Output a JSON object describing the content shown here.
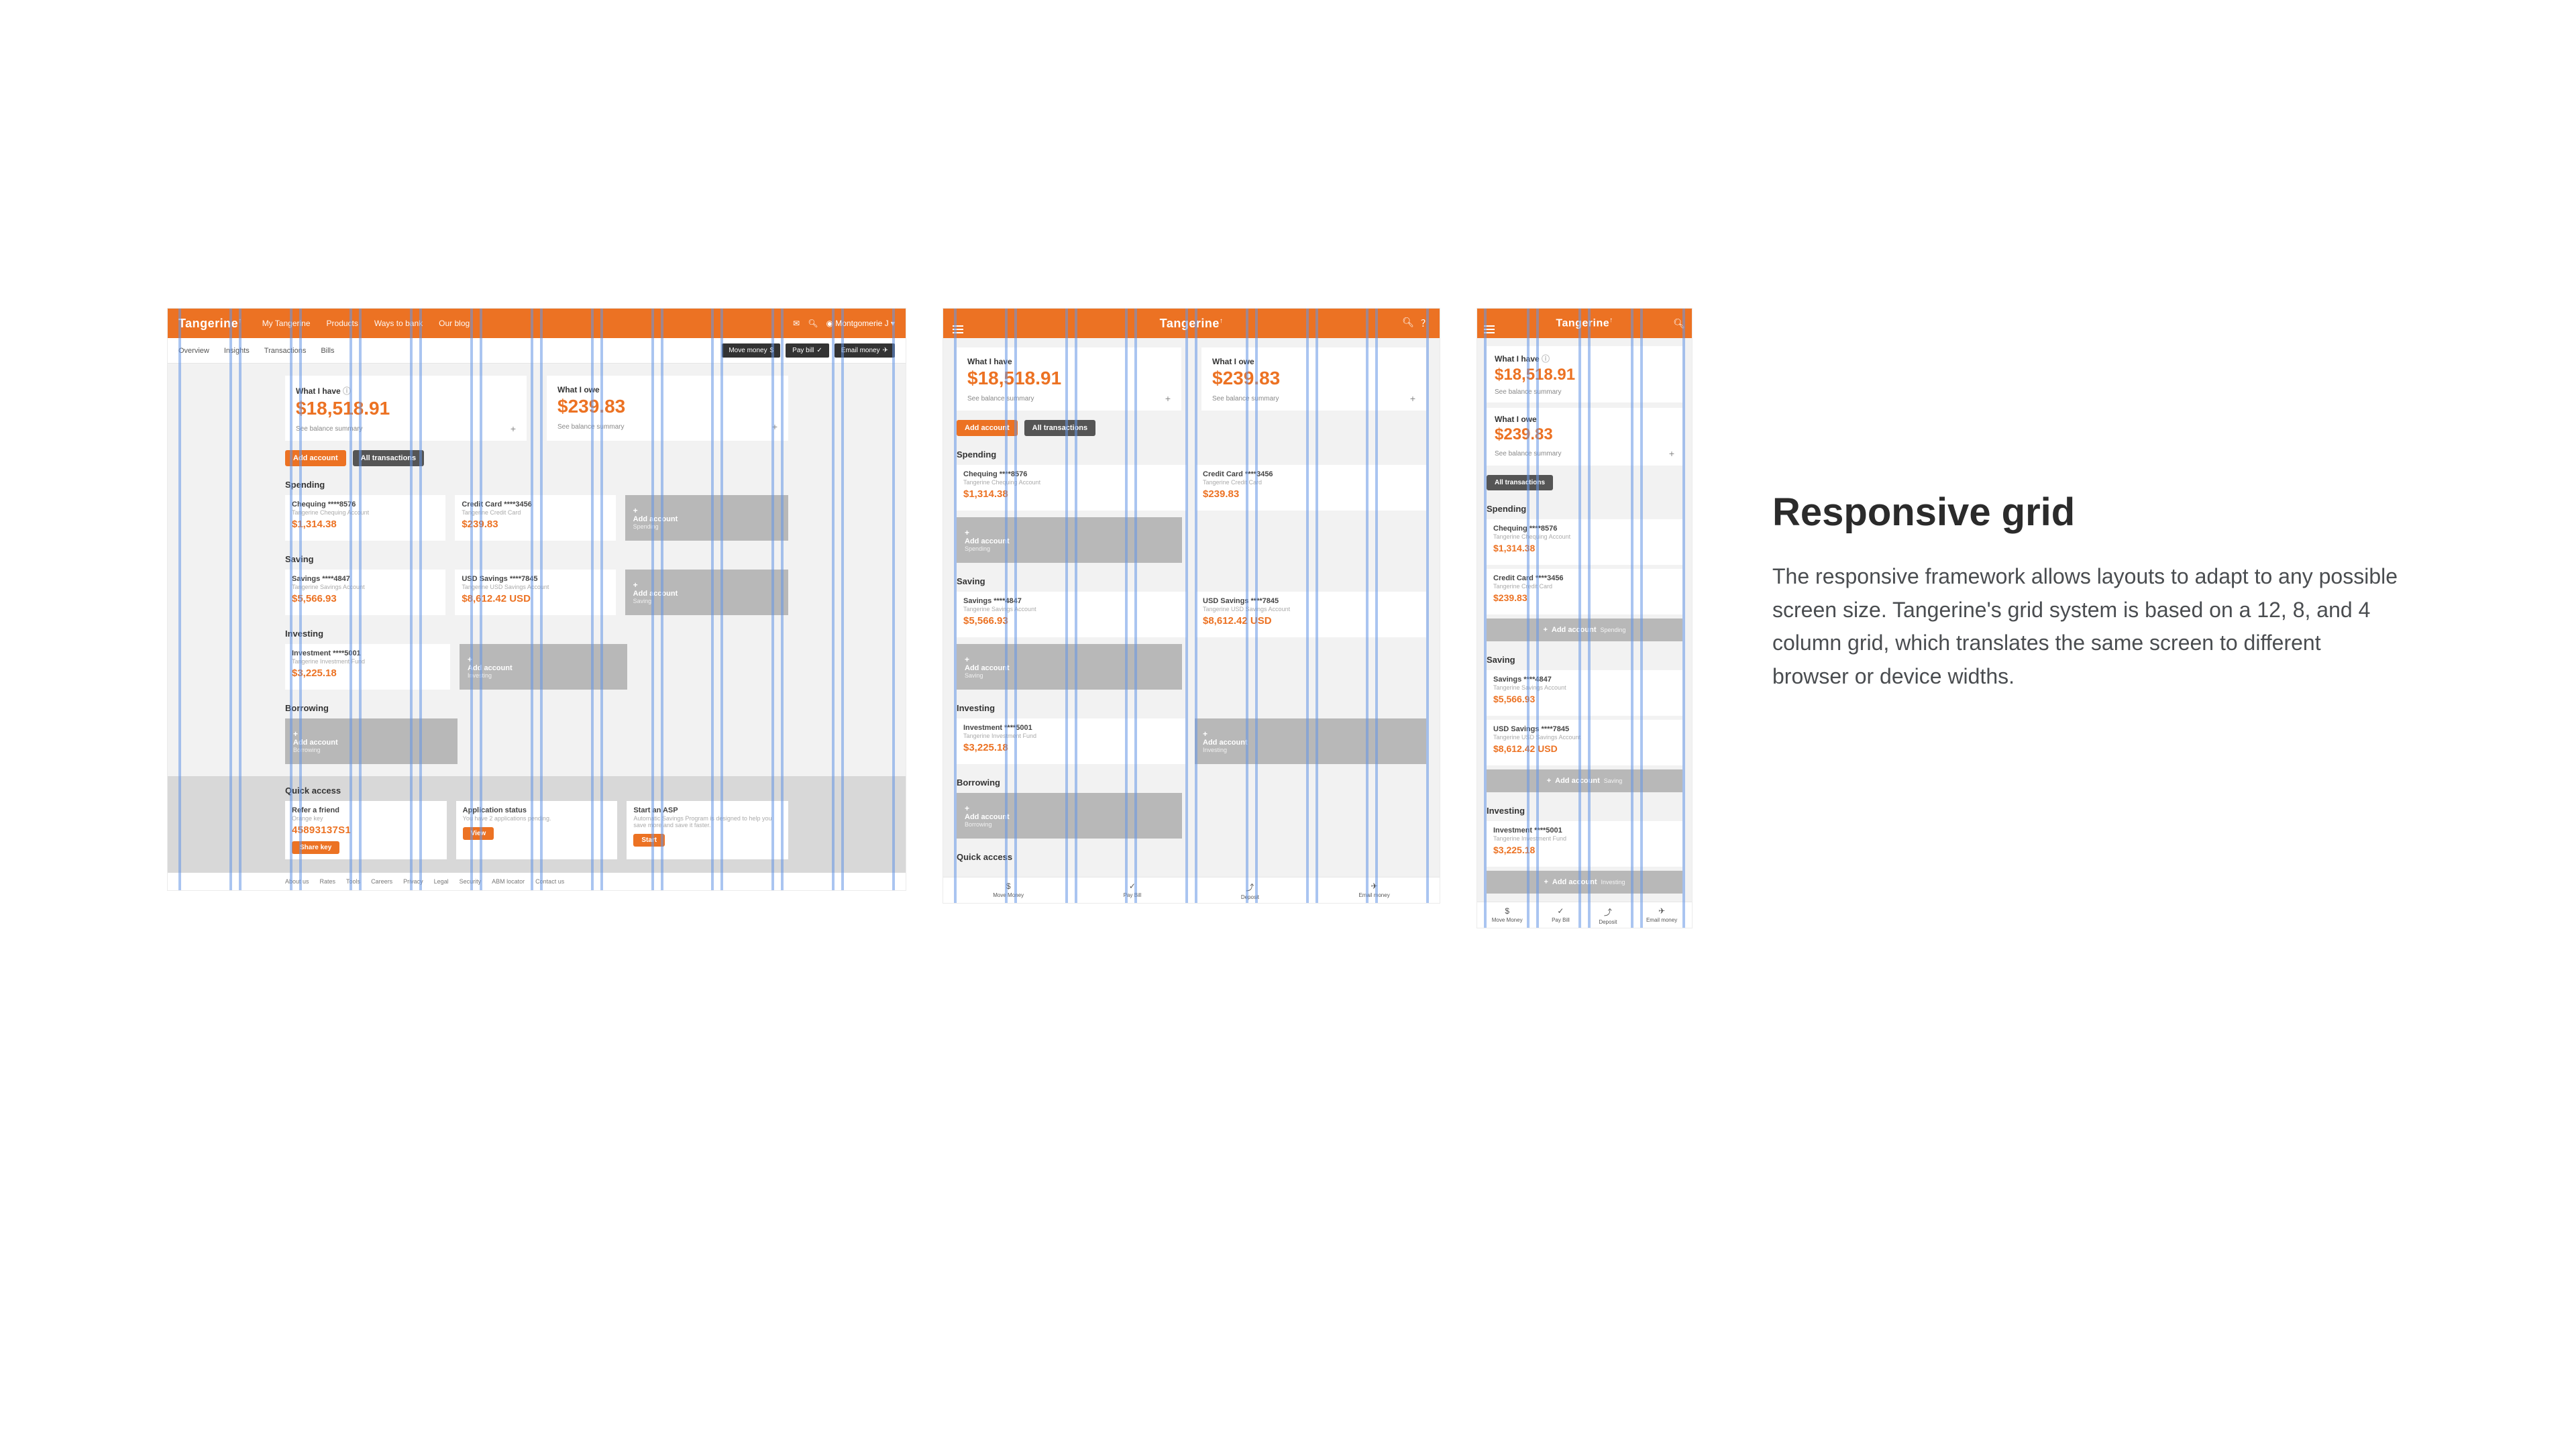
{
  "article": {
    "heading": "Responsive grid",
    "body": "The responsive framework allows layouts to adapt to any possible screen size. Tangerine's grid system is based on a 12, 8, and 4 column grid, which translates the same screen to different browser or device widths."
  },
  "brand": "Tangerine",
  "desktop_nav": [
    "My Tangerine",
    "Products",
    "Ways to bank",
    "Our blog"
  ],
  "desktop_user": "Montgomerie J",
  "desktop_tabs": [
    "Overview",
    "Insights",
    "Transactions",
    "Bills"
  ],
  "dark_actions": [
    "Move money",
    "Pay bill",
    "Email money"
  ],
  "summaries": {
    "have": {
      "label": "What I have",
      "amount": "$18,518.91",
      "sub": "See balance summary"
    },
    "owe": {
      "label": "What I owe",
      "amount": "$239.83",
      "sub": "See balance summary"
    }
  },
  "buttons": {
    "add_account": "Add account",
    "all_tx": "All transactions"
  },
  "sections": {
    "spending": "Spending",
    "saving": "Saving",
    "investing": "Investing",
    "borrowing": "Borrowing",
    "quick": "Quick access"
  },
  "accounts": {
    "chequing": {
      "title": "Chequing ****8576",
      "sub": "Tangerine Chequing Account",
      "amt": "$1,314.38"
    },
    "credit": {
      "title": "Credit Card ****3456",
      "sub": "Tangerine Credit Card",
      "amt": "$239.83"
    },
    "savings": {
      "title": "Savings ****4847",
      "sub": "Tangerine Savings Account",
      "amt": "$5,566.93"
    },
    "usd": {
      "title": "USD Savings ****7845",
      "sub": "Tangerine USD Savings Account",
      "amt": "$8,612.42 USD"
    },
    "invest": {
      "title": "Investment ****5001",
      "sub": "Tangerine Investment Fund",
      "amt": "$3,225.18"
    }
  },
  "ghost": {
    "add": "Add account",
    "spending": "Spending",
    "saving": "Saving",
    "investing": "Investing",
    "borrowing": "Borrowing"
  },
  "quick_cards": {
    "refer": {
      "t": "Refer a friend",
      "s": "Orange key",
      "code": "45893137S1",
      "btn": "Share key"
    },
    "app": {
      "t": "Application status",
      "s": "You have 2 applications pending.",
      "btn": "View"
    },
    "asp": {
      "t": "Start an ASP",
      "s": "Automatic Savings Program is designed to help you save more and save it faster.",
      "btn": "Start"
    }
  },
  "footer_links": [
    "About us",
    "Rates",
    "Tools",
    "Careers",
    "Privacy",
    "Legal",
    "Security",
    "ABM locator",
    "Contact us"
  ],
  "bottom_nav": [
    {
      "icon": "$",
      "label": "Move Money"
    },
    {
      "icon": "✓",
      "label": "Pay Bill"
    },
    {
      "icon": "⤴",
      "label": "Deposit"
    },
    {
      "icon": "✈",
      "label": "Email money"
    }
  ],
  "grid_columns": {
    "desktop": 12,
    "tablet": 8,
    "mobile": 4
  }
}
